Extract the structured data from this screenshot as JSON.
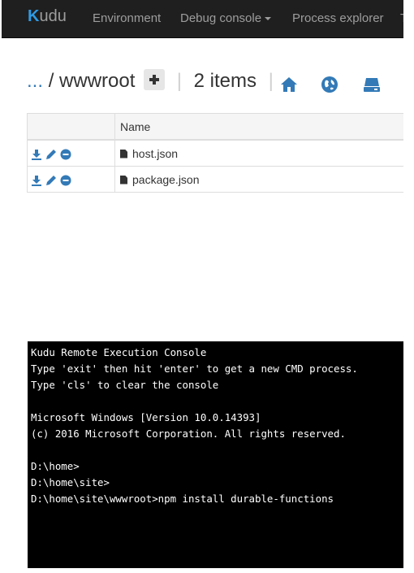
{
  "navbar": {
    "brand_first": "K",
    "brand_rest": "udu",
    "items": [
      {
        "label": "Environment"
      },
      {
        "label": "Debug console"
      },
      {
        "label": "Process explorer"
      },
      {
        "label": "T"
      }
    ]
  },
  "breadcrumb": {
    "ellipsis": "...",
    "slash": "/",
    "folder": "wwwroot",
    "separator": "|",
    "item_count": "2 items"
  },
  "icons": {
    "home": "home-icon",
    "globe": "globe-icon",
    "drive": "drive-icon",
    "download": "download-icon",
    "edit": "pencil-icon",
    "delete": "minus-circle-icon",
    "file": "file-icon"
  },
  "colors": {
    "accent": "#337ab7",
    "navbar_bg": "#1f1f1f",
    "console_bg": "#000000"
  },
  "table": {
    "column_header": "Name",
    "rows": [
      {
        "name": "host.json"
      },
      {
        "name": "package.json"
      }
    ]
  },
  "console": {
    "lines": [
      "Kudu Remote Execution Console",
      "Type 'exit' then hit 'enter' to get a new CMD process.",
      "Type 'cls' to clear the console",
      "",
      "Microsoft Windows [Version 10.0.14393]",
      "(c) 2016 Microsoft Corporation. All rights reserved.",
      "",
      "D:\\home>",
      "D:\\home\\site>",
      "D:\\home\\site\\wwwroot>npm install durable-functions"
    ]
  }
}
